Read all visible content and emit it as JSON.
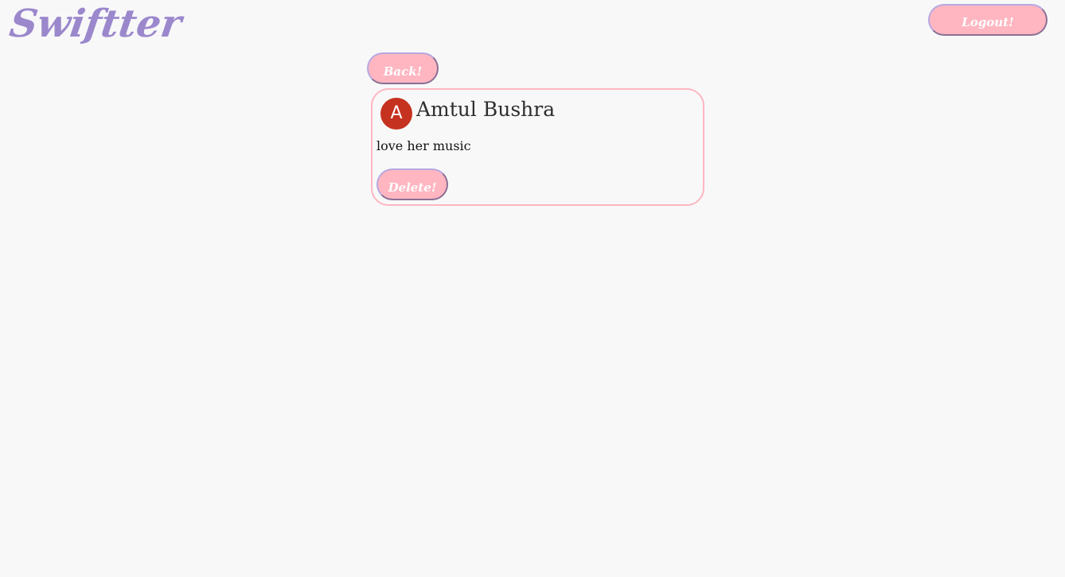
{
  "header": {
    "logo_text": "Swiftter",
    "logout_label": "Logout!"
  },
  "nav": {
    "back_label": "Back!"
  },
  "post": {
    "avatar_letter": "A",
    "author": "Amtul Bushra",
    "text": "love her music",
    "delete_label": "Delete!"
  },
  "colors": {
    "background": "#f8f8f9",
    "logo": "#9b88cc",
    "button_fill": "#ffb6c1",
    "card_border": "#ffb6c1",
    "avatar": "#c5321f"
  }
}
